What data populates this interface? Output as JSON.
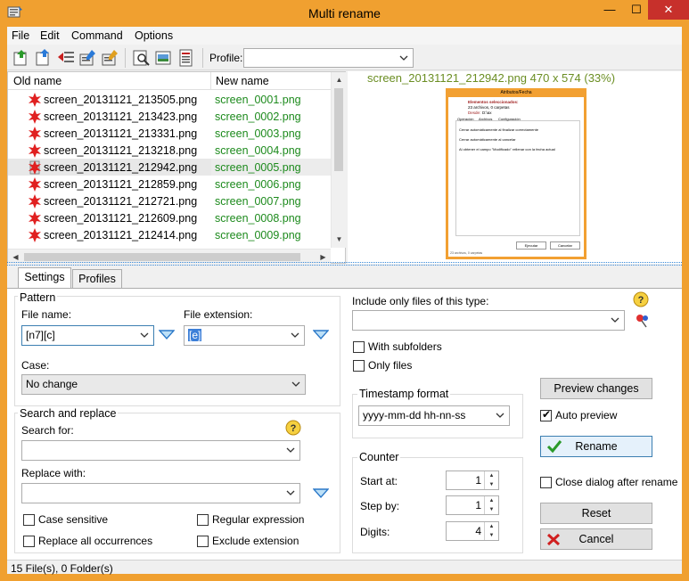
{
  "window": {
    "title": "Multi rename",
    "min": "—",
    "max": "☐",
    "close": "✕"
  },
  "menu": [
    "File",
    "Edit",
    "Command",
    "Options"
  ],
  "toolbar": {
    "profile_label": "Profile:",
    "profile_value": ""
  },
  "list": {
    "col_old": "Old name",
    "col_new": "New name",
    "rows": [
      {
        "old": "screen_20131121_213505.png",
        "new": "screen_0001.png"
      },
      {
        "old": "screen_20131121_213423.png",
        "new": "screen_0002.png"
      },
      {
        "old": "screen_20131121_213331.png",
        "new": "screen_0003.png"
      },
      {
        "old": "screen_20131121_213218.png",
        "new": "screen_0004.png"
      },
      {
        "old": "screen_20131121_212942.png",
        "new": "screen_0005.png"
      },
      {
        "old": "screen_20131121_212859.png",
        "new": "screen_0006.png"
      },
      {
        "old": "screen_20131121_212721.png",
        "new": "screen_0007.png"
      },
      {
        "old": "screen_20131121_212609.png",
        "new": "screen_0008.png"
      },
      {
        "old": "screen_20131121_212414.png",
        "new": "screen_0009.png"
      }
    ]
  },
  "preview": {
    "caption": "screen_20131121_212942.png   470 x 574 (33%)",
    "mini_title": "Atributos/Fecha",
    "mini_line1": "Elementos seleccionados:",
    "mini_line2": "23 archivos, 0 carpetas",
    "mini_line3": "Desde:",
    "mini_line3b": "D:\\ax",
    "mini_tabs": [
      "Operación",
      "Archivos",
      "Configuración"
    ],
    "mini_opts": [
      "Cerrar automáticamente al finalizar correctamente",
      "Cerrar automáticamente al cancelar",
      "Al obtener el campo \"Modificado\" rellenar con la fecha actual"
    ],
    "mini_ok": "Ejecutar",
    "mini_cancel": "Cancelar",
    "mini_status": "23 archivos, 0 carpetas"
  },
  "tabs": [
    "Settings",
    "Profiles"
  ],
  "pattern": {
    "group": "Pattern",
    "file_name_label": "File name:",
    "file_name_value": "[n7][c]",
    "ext_label": "File extension:",
    "ext_value": "[e]",
    "case_label": "Case:",
    "case_value": "No change"
  },
  "search": {
    "group": "Search and replace",
    "search_label": "Search for:",
    "search_value": "",
    "replace_label": "Replace with:",
    "replace_value": "",
    "case_sensitive": "Case sensitive",
    "regex": "Regular expression",
    "replace_all": "Replace all occurrences",
    "exclude_ext": "Exclude extension"
  },
  "filter": {
    "label": "Include only files of this type:",
    "value": "",
    "with_sub": "With subfolders",
    "only_files": "Only files"
  },
  "timestamp": {
    "group": "Timestamp format",
    "value": "yyyy-mm-dd hh-nn-ss"
  },
  "counter": {
    "group": "Counter",
    "start_label": "Start at:",
    "start": "1",
    "step_label": "Step by:",
    "step": "1",
    "digits_label": "Digits:",
    "digits": "4"
  },
  "actions": {
    "preview_changes": "Preview changes",
    "auto_preview": "Auto preview",
    "rename": "Rename",
    "close_after": "Close dialog after rename",
    "reset": "Reset",
    "cancel": "Cancel"
  },
  "status": "15 File(s), 0 Folder(s)"
}
